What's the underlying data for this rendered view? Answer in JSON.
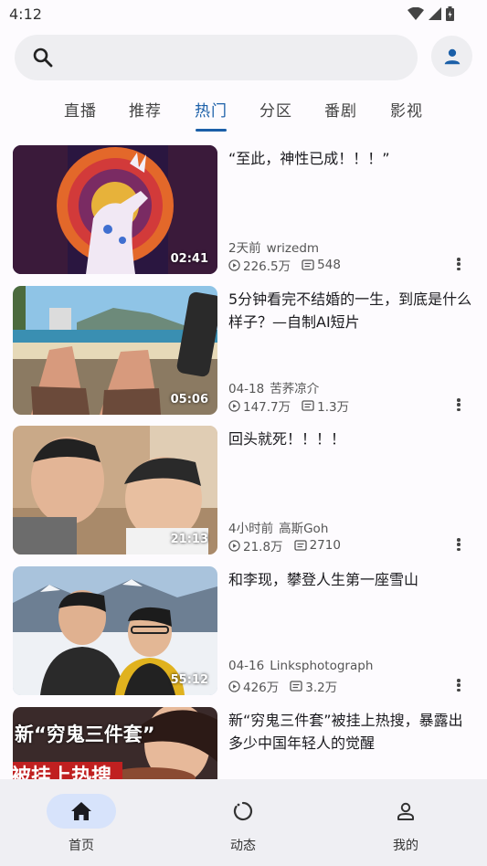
{
  "status": {
    "time": "4:12"
  },
  "search": {
    "icon": "search-icon"
  },
  "tabs": [
    {
      "label": "直播"
    },
    {
      "label": "推荐"
    },
    {
      "label": "热门"
    },
    {
      "label": "分区"
    },
    {
      "label": "番剧"
    },
    {
      "label": "影视"
    }
  ],
  "active_tab": "热门",
  "videos": [
    {
      "title": "“至此，神性已成！！！”",
      "time": "2天前",
      "author": "wrizedm",
      "views": "226.5万",
      "danmaku": "548",
      "duration": "02:41"
    },
    {
      "title": "5分钟看完不结婚的一生，到底是什么样子？—自制AI短片",
      "time": "04-18",
      "author": "苦荞凉介",
      "views": "147.7万",
      "danmaku": "1.3万",
      "duration": "05:06"
    },
    {
      "title": "回头就死！！！！",
      "time": "4小时前",
      "author": "高斯Goh",
      "views": "21.8万",
      "danmaku": "2710",
      "duration": "21:13"
    },
    {
      "title": "和李现，攀登人生第一座雪山",
      "time": "04-16",
      "author": "Linksphotograph",
      "views": "426万",
      "danmaku": "3.2万",
      "duration": "55:12"
    },
    {
      "title": "新“穷鬼三件套”被挂上热搜，暴露出多少中国年轻人的觉醒",
      "time": "",
      "author": "",
      "views": "",
      "danmaku": "",
      "duration": ""
    }
  ],
  "thumb5_text": {
    "line1": "新“穷鬼三件套”",
    "line2": "被挂上热搜"
  },
  "nav": [
    {
      "label": "首页",
      "icon": "home-icon"
    },
    {
      "label": "动态",
      "icon": "activity-icon"
    },
    {
      "label": "我的",
      "icon": "person-icon"
    }
  ],
  "colors": {
    "accent": "#1b5fa8",
    "nav_active": "#d7e3fb",
    "background": "#fdfbfe"
  }
}
